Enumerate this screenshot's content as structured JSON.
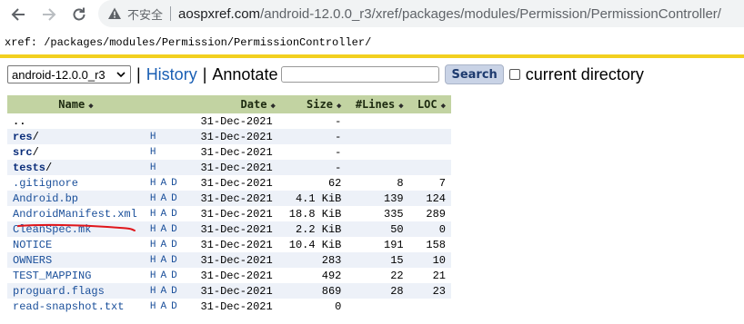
{
  "browser": {
    "insecure_label": "不安全",
    "url_host": "aospxref.com",
    "url_path": "/android-12.0.0_r3/xref/packages/modules/Permission/PermissionController/"
  },
  "xref_path": "xref: /packages/modules/Permission/PermissionController/",
  "toolbar": {
    "project": "android-12.0.0_r3",
    "history": "History",
    "separator": "|",
    "annotate": "Annotate",
    "search_value": "",
    "search_button": "Search",
    "current_directory": "current directory"
  },
  "table": {
    "headers": {
      "name": "Name",
      "date": "Date",
      "size": "Size",
      "lines": "#Lines",
      "loc": "LOC"
    },
    "rows": [
      {
        "name": "..",
        "date": "31-Dec-2021",
        "size": "-",
        "lines": "",
        "loc": ""
      },
      {
        "name": "res",
        "slash": "/",
        "h": "H",
        "date": "31-Dec-2021",
        "size": "-",
        "lines": "",
        "loc": ""
      },
      {
        "name": "src",
        "slash": "/",
        "h": "H",
        "date": "31-Dec-2021",
        "size": "-",
        "lines": "",
        "loc": ""
      },
      {
        "name": "tests",
        "slash": "/",
        "h": "H",
        "date": "31-Dec-2021",
        "size": "-",
        "lines": "",
        "loc": ""
      },
      {
        "name": ".gitignore",
        "h": "H",
        "a": "A",
        "d": "D",
        "date": "31-Dec-2021",
        "size": "62",
        "lines": "8",
        "loc": "7"
      },
      {
        "name": "Android.bp",
        "h": "H",
        "a": "A",
        "d": "D",
        "date": "31-Dec-2021",
        "size": "4.1 KiB",
        "lines": "139",
        "loc": "124"
      },
      {
        "name": "AndroidManifest.xml",
        "h": "H",
        "a": "A",
        "d": "D",
        "date": "31-Dec-2021",
        "size": "18.8 KiB",
        "lines": "335",
        "loc": "289"
      },
      {
        "name": "CleanSpec.mk",
        "h": "H",
        "a": "A",
        "d": "D",
        "date": "31-Dec-2021",
        "size": "2.2 KiB",
        "lines": "50",
        "loc": "0"
      },
      {
        "name": "NOTICE",
        "h": "H",
        "a": "A",
        "d": "D",
        "date": "31-Dec-2021",
        "size": "10.4 KiB",
        "lines": "191",
        "loc": "158"
      },
      {
        "name": "OWNERS",
        "h": "H",
        "a": "A",
        "d": "D",
        "date": "31-Dec-2021",
        "size": "283",
        "lines": "15",
        "loc": "10"
      },
      {
        "name": "TEST_MAPPING",
        "h": "H",
        "a": "A",
        "d": "D",
        "date": "31-Dec-2021",
        "size": "492",
        "lines": "22",
        "loc": "21"
      },
      {
        "name": "proguard.flags",
        "h": "H",
        "a": "A",
        "d": "D",
        "date": "31-Dec-2021",
        "size": "869",
        "lines": "28",
        "loc": "23"
      },
      {
        "name": "read-snapshot.txt",
        "h": "H",
        "a": "A",
        "d": "D",
        "date": "31-Dec-2021",
        "size": "0",
        "lines": "",
        "loc": ""
      }
    ]
  },
  "colors": {
    "header_bg": "#c2d3a2",
    "stripe_bg": "#edf1f8",
    "rule": "#f2d01f",
    "link": "#1a4f9a",
    "underline": "#e0161b"
  }
}
